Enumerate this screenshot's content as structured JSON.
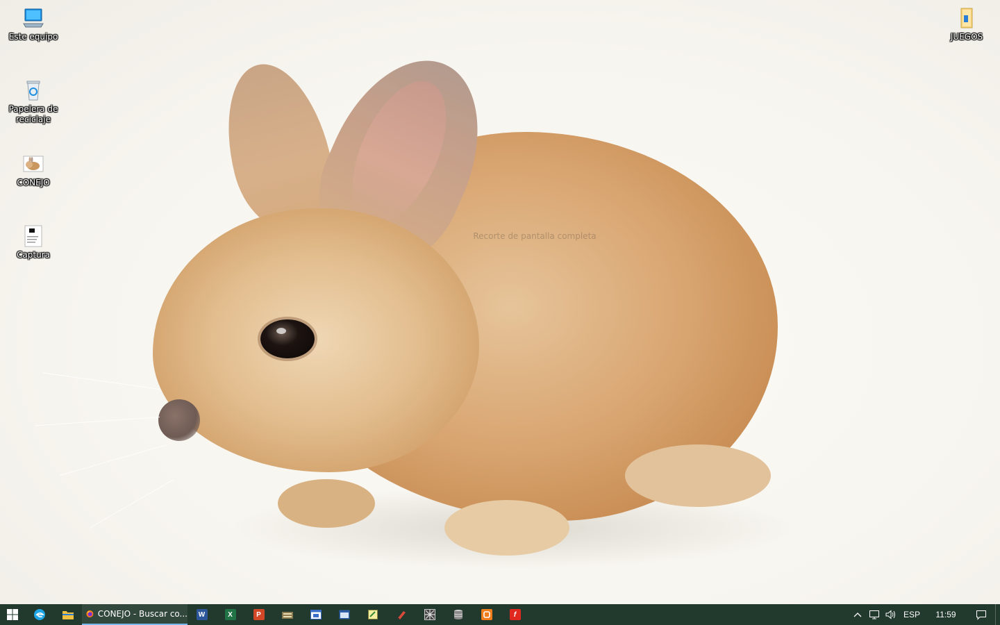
{
  "desktop": {
    "wallpaper_overlay_text": "Recorte de pantalla completa",
    "icons": [
      {
        "label": "Este equipo",
        "icon": "computer-icon"
      },
      {
        "label": "Papelera de reciclaje",
        "icon": "recycle-bin-icon"
      },
      {
        "label": "CONEJO",
        "icon": "image-file-icon"
      },
      {
        "label": "Captura",
        "icon": "image-file-icon"
      },
      {
        "label": "JUEGOS",
        "icon": "folder-icon"
      }
    ]
  },
  "taskbar": {
    "start_icon": "windows-start-icon",
    "pinned": [
      {
        "name": "edge",
        "icon": "edge-icon",
        "color": "#1da5e6"
      },
      {
        "name": "file-explorer",
        "icon": "folder-icon",
        "color": "#f0c040"
      },
      {
        "name": "word",
        "icon": "word-icon",
        "glyph": "W",
        "color": "#2b579a"
      },
      {
        "name": "excel",
        "icon": "excel-icon",
        "glyph": "X",
        "color": "#217346"
      },
      {
        "name": "powerpoint",
        "icon": "powerpoint-icon",
        "glyph": "P",
        "color": "#d24726"
      },
      {
        "name": "app-a",
        "icon": "toolbox-icon",
        "color": "#8a7a50"
      },
      {
        "name": "app-b",
        "icon": "window-app-icon",
        "color": "#3a6ec8"
      },
      {
        "name": "app-c",
        "icon": "window-app-icon",
        "color": "#2c5fa8"
      },
      {
        "name": "notepad",
        "icon": "notepad-icon",
        "color": "#d8d36a"
      },
      {
        "name": "paint",
        "icon": "brush-icon",
        "color": "#d84b3a"
      },
      {
        "name": "app-d",
        "icon": "grid-app-icon",
        "color": "#9a9a9a"
      },
      {
        "name": "app-e",
        "icon": "stack-icon",
        "color": "#b0b0b0"
      },
      {
        "name": "app-f",
        "icon": "app-icon",
        "color": "#ef7d1b"
      },
      {
        "name": "app-g",
        "icon": "f-app-icon",
        "glyph": "f",
        "color": "#e0281e"
      }
    ],
    "firefox_window": {
      "title": "CONEJO - Buscar co...",
      "icon": "firefox-icon"
    },
    "tray": {
      "chevron_icon": "chevron-up-icon",
      "network_icon": "network-icon",
      "volume_icon": "volume-icon",
      "language": "ESP",
      "time": "11:59",
      "notifications_icon": "notification-icon"
    }
  }
}
